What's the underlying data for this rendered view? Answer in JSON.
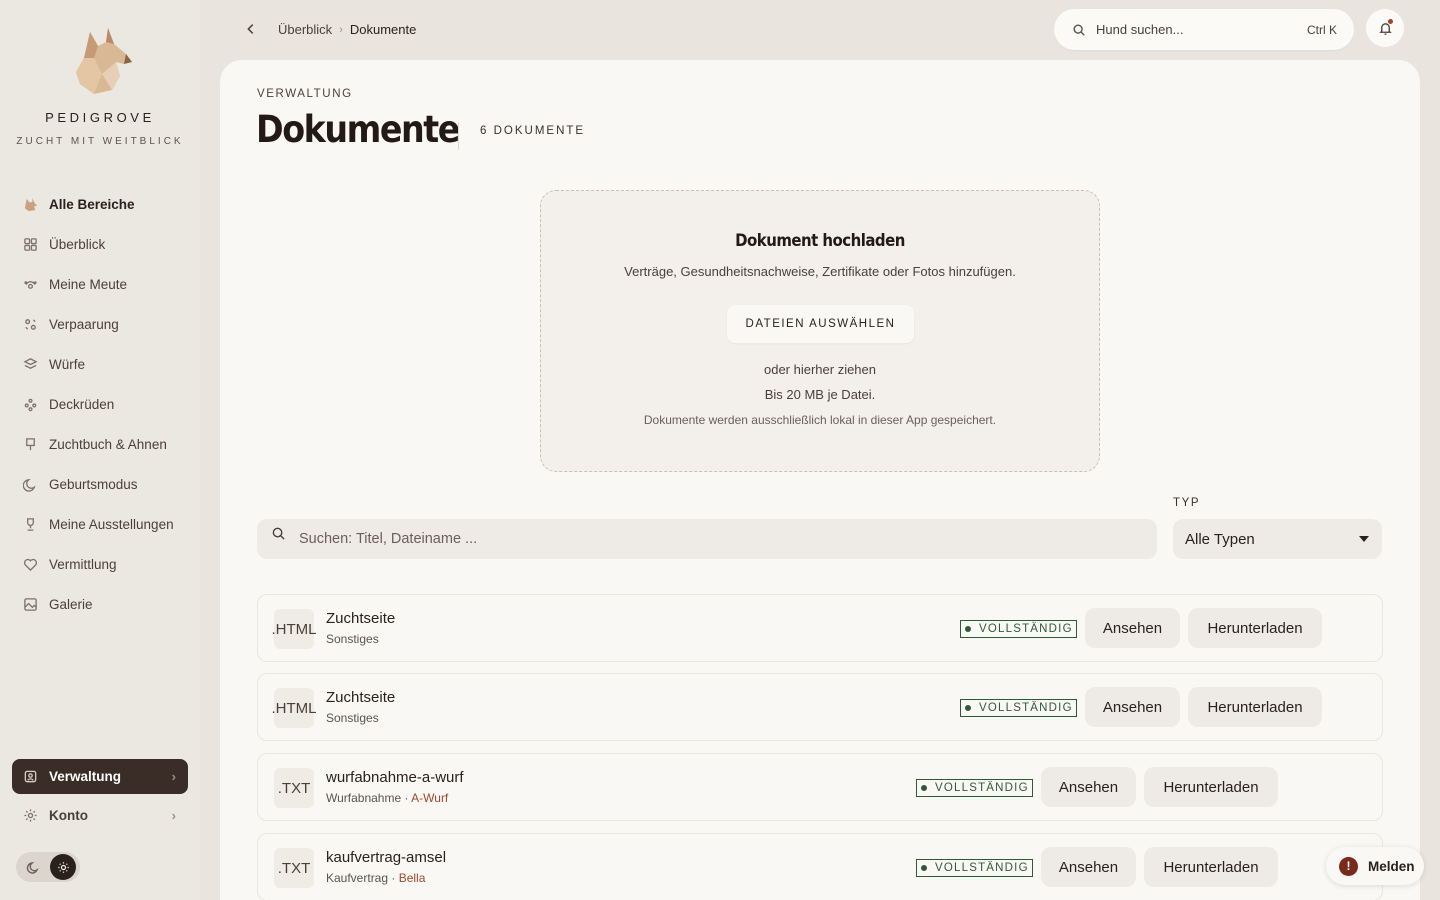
{
  "app": {
    "brand": "PEDIGROVE",
    "tagline": "ZUCHT MIT WEITBLICK"
  },
  "sidebar": {
    "items": [
      {
        "label": "Alle Bereiche",
        "icon": "dog-icon"
      },
      {
        "label": "Überblick",
        "icon": "grid-icon"
      },
      {
        "label": "Meine Meute",
        "icon": "paw-icon"
      },
      {
        "label": "Verpaarung",
        "icon": "pairing-icon"
      },
      {
        "label": "Würfe",
        "icon": "layers-icon"
      },
      {
        "label": "Deckrüden",
        "icon": "stud-icon"
      },
      {
        "label": "Zuchtbuch & Ahnen",
        "icon": "book-icon"
      },
      {
        "label": "Geburtsmodus",
        "icon": "moon-icon"
      },
      {
        "label": "Meine Ausstellungen",
        "icon": "trophy-icon"
      },
      {
        "label": "Vermittlung",
        "icon": "heart-icon"
      },
      {
        "label": "Galerie",
        "icon": "image-icon"
      }
    ],
    "active": {
      "label": "Verwaltung",
      "icon": "admin-icon"
    },
    "account": {
      "label": "Konto",
      "icon": "gear-icon"
    }
  },
  "topbar": {
    "breadcrumb": [
      "Überblick",
      "Dokumente"
    ],
    "search_placeholder": "Hund suchen...",
    "search_shortcut": "Ctrl K"
  },
  "page": {
    "eyebrow": "VERWALTUNG",
    "title": "Dokumente",
    "count": "6 DOKUMENTE"
  },
  "upload": {
    "title": "Dokument hochladen",
    "description": "Verträge, Gesundheitsnachweise, Zertifikate oder Fotos hinzufügen.",
    "button": "DATEIEN AUSWÄHLEN",
    "or_drag": "oder hierher ziehen",
    "limit": "Bis 20 MB je Datei.",
    "note": "Dokumente werden ausschließlich lokal in dieser App gespeichert."
  },
  "filters": {
    "search_placeholder": "Suchen: Titel, Dateiname ...",
    "type_label": "TYP",
    "type_value": "Alle Typen"
  },
  "documents": [
    {
      "ext": ".HTML",
      "name": "Zuchtseite",
      "category": "Sonstiges",
      "link": "",
      "status": "VOLLSTÄNDIG",
      "view": "Ansehen",
      "download": "Herunterladen"
    },
    {
      "ext": ".HTML",
      "name": "Zuchtseite",
      "category": "Sonstiges",
      "link": "",
      "status": "VOLLSTÄNDIG",
      "view": "Ansehen",
      "download": "Herunterladen"
    },
    {
      "ext": ".TXT",
      "name": "wurfabnahme-a-wurf",
      "category": "Wurfabnahme · ",
      "link": "A-Wurf",
      "status": "VOLLSTÄNDIG",
      "view": "Ansehen",
      "download": "Herunterladen"
    },
    {
      "ext": ".TXT",
      "name": "kaufvertrag-amsel",
      "category": "Kaufvertrag · ",
      "link": "Bella",
      "status": "VOLLSTÄNDIG",
      "view": "Ansehen",
      "download": "Herunterladen"
    }
  ],
  "report": {
    "label": "Melden",
    "icon_text": "!"
  },
  "colors": {
    "accent_dark": "#3a2c26",
    "status_green": "#2f5a36",
    "link_red": "#9c4a2f",
    "report_red": "#7a2a1a"
  }
}
